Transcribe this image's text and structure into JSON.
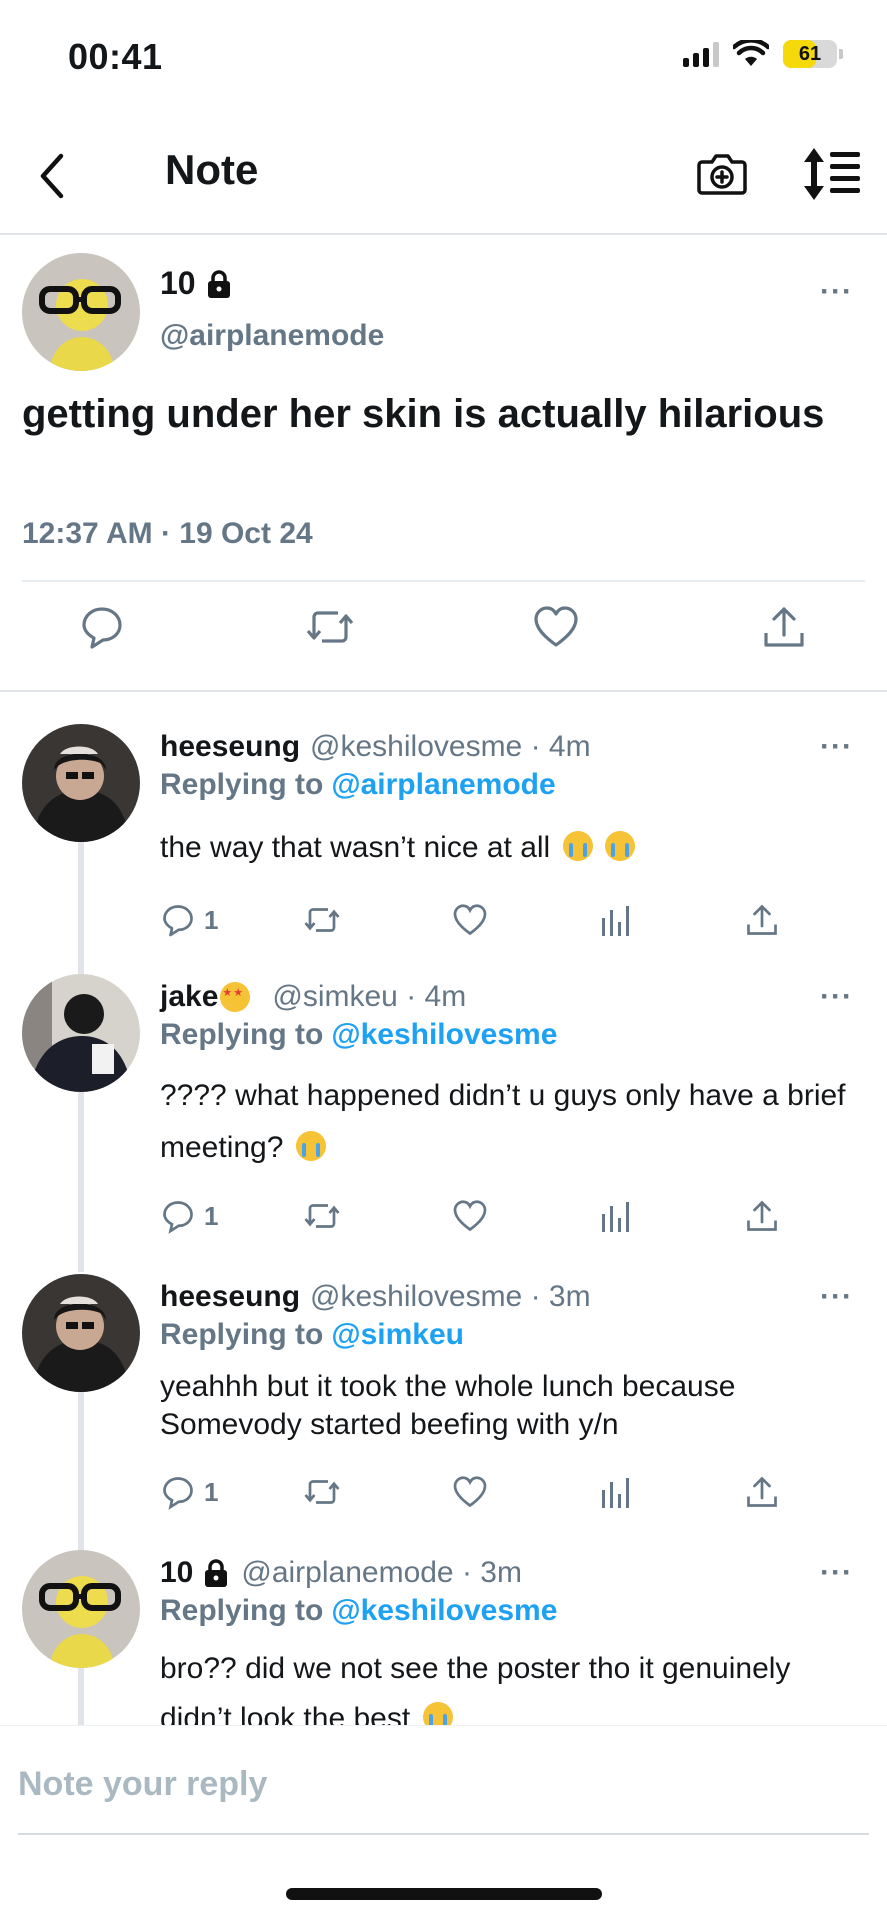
{
  "status_bar": {
    "time": "00:41",
    "battery": "61",
    "battery_level": 0.61
  },
  "nav": {
    "title": "Note"
  },
  "main_tweet": {
    "name": "10",
    "handle": "@airplanemode",
    "text": "getting under her skin is actually hilarious",
    "timestamp": "12:37 AM · 19 Oct 24",
    "more": "···"
  },
  "replies": [
    {
      "name": "heeseung",
      "handle": "@keshilovesme · 4m",
      "replying_label": "Replying to",
      "replying_to": "@airplanemode",
      "text": "the way that wasn’t nice at all",
      "reply_count": "1",
      "more": "···"
    },
    {
      "name": "jake",
      "handle": "@simkeu · 4m",
      "replying_label": "Replying to",
      "replying_to": "@keshilovesme",
      "text": "???? what happened didn’t u guys only have a brief meeting?",
      "reply_count": "1",
      "more": "···"
    },
    {
      "name": "heeseung",
      "handle": "@keshilovesme · 3m",
      "replying_label": "Replying to",
      "replying_to": "@simkeu",
      "text": "yeahhh but it took the whole lunch because Somevody started beefing with y/n",
      "reply_count": "1",
      "more": "···"
    },
    {
      "name": "10",
      "handle": "@airplanemode · 3m",
      "replying_label": "Replying to",
      "replying_to": "@keshilovesme",
      "text": "bro?? did we not see the poster tho it genuinely didn’t look the best",
      "more": "···"
    }
  ],
  "reply_bar": {
    "placeholder": "Note your reply"
  },
  "colors": {
    "link": "#1da1f2",
    "muted": "#657786",
    "text": "#14171a",
    "divider": "#e1e4e8"
  },
  "icons": [
    "back-chevron-icon",
    "camera-plus-icon",
    "sort-icon",
    "lock-icon",
    "comment-icon",
    "retweet-icon",
    "like-icon",
    "share-icon",
    "analytics-icon"
  ]
}
